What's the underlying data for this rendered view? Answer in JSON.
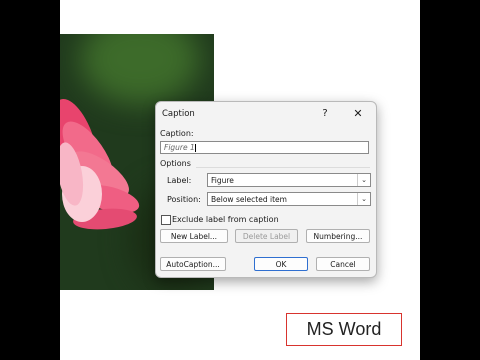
{
  "brand_badge": "MS Word",
  "dialog": {
    "title": "Caption",
    "help_button": "?",
    "close_button": "✕",
    "caption_label": "Caption:",
    "caption_value": "Figure 1",
    "options_header": "Options",
    "label_label": "Label:",
    "label_value": "Figure",
    "position_label": "Position:",
    "position_value": "Below selected item",
    "exclude_label": "Exclude label from caption",
    "exclude_checked": false,
    "buttons": {
      "new_label": "New Label...",
      "delete_label": "Delete Label",
      "numbering": "Numbering...",
      "autocaption": "AutoCaption...",
      "ok": "OK",
      "cancel": "Cancel"
    }
  },
  "colors": {
    "badge_border": "#d8342e",
    "ok_border": "#2f6fd0",
    "flower_pink": "#f0527a",
    "leaf_green": "#203a1d"
  }
}
